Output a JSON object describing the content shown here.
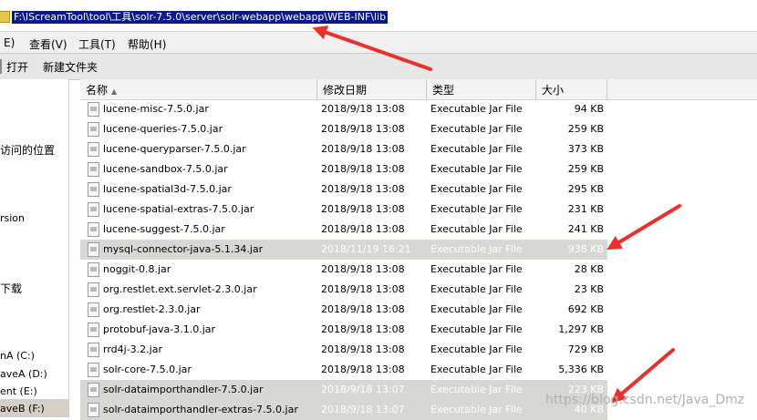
{
  "address": {
    "path": "F:\\IScreamTool\\tool\\工具\\solr-7.5.0\\server\\solr-webapp\\webapp\\WEB-INF\\lib"
  },
  "menu": {
    "edit": "E)",
    "view": "查看(V)",
    "tools": "工具(T)",
    "help": "帮助(H)"
  },
  "toolbar": {
    "open": "打开",
    "new_folder": "新建文件夹"
  },
  "nav": {
    "recent": "访问的位置",
    "version": "rsion",
    "download": "下载",
    "drive_c": "nA (C:)",
    "drive_d": "aveA (D:)",
    "drive_e": "ent (E:)",
    "drive_f": "aveB (F:)"
  },
  "columns": {
    "name": "名称",
    "modified": "修改日期",
    "type": "类型",
    "size": "大小"
  },
  "files": [
    {
      "name": "lucene-misc-7.5.0.jar",
      "modified": "2018/9/18 13:08",
      "type": "Executable Jar File",
      "size": "94 KB",
      "highlighted": false
    },
    {
      "name": "lucene-queries-7.5.0.jar",
      "modified": "2018/9/18 13:08",
      "type": "Executable Jar File",
      "size": "259 KB",
      "highlighted": false
    },
    {
      "name": "lucene-queryparser-7.5.0.jar",
      "modified": "2018/9/18 13:08",
      "type": "Executable Jar File",
      "size": "373 KB",
      "highlighted": false
    },
    {
      "name": "lucene-sandbox-7.5.0.jar",
      "modified": "2018/9/18 13:08",
      "type": "Executable Jar File",
      "size": "259 KB",
      "highlighted": false
    },
    {
      "name": "lucene-spatial3d-7.5.0.jar",
      "modified": "2018/9/18 13:08",
      "type": "Executable Jar File",
      "size": "295 KB",
      "highlighted": false
    },
    {
      "name": "lucene-spatial-extras-7.5.0.jar",
      "modified": "2018/9/18 13:08",
      "type": "Executable Jar File",
      "size": "231 KB",
      "highlighted": false
    },
    {
      "name": "lucene-suggest-7.5.0.jar",
      "modified": "2018/9/18 13:08",
      "type": "Executable Jar File",
      "size": "241 KB",
      "highlighted": false
    },
    {
      "name": "mysql-connector-java-5.1.34.jar",
      "modified": "2018/11/19 16:21",
      "type": "Executable Jar File",
      "size": "938 KB",
      "highlighted": true
    },
    {
      "name": "noggit-0.8.jar",
      "modified": "2018/9/18 13:08",
      "type": "Executable Jar File",
      "size": "28 KB",
      "highlighted": false
    },
    {
      "name": "org.restlet.ext.servlet-2.3.0.jar",
      "modified": "2018/9/18 13:08",
      "type": "Executable Jar File",
      "size": "23 KB",
      "highlighted": false
    },
    {
      "name": "org.restlet-2.3.0.jar",
      "modified": "2018/9/18 13:08",
      "type": "Executable Jar File",
      "size": "692 KB",
      "highlighted": false
    },
    {
      "name": "protobuf-java-3.1.0.jar",
      "modified": "2018/9/18 13:08",
      "type": "Executable Jar File",
      "size": "1,297 KB",
      "highlighted": false
    },
    {
      "name": "rrd4j-3.2.jar",
      "modified": "2018/9/18 13:08",
      "type": "Executable Jar File",
      "size": "729 KB",
      "highlighted": false
    },
    {
      "name": "solr-core-7.5.0.jar",
      "modified": "2018/9/18 13:08",
      "type": "Executable Jar File",
      "size": "5,336 KB",
      "highlighted": false
    },
    {
      "name": "solr-dataimporthandler-7.5.0.jar",
      "modified": "2018/9/18 13:07",
      "type": "Executable Jar File",
      "size": "223 KB",
      "highlighted": true
    },
    {
      "name": "solr-dataimporthandler-extras-7.5.0.jar",
      "modified": "2018/9/18 13:07",
      "type": "Executable Jar File",
      "size": "40 KB",
      "highlighted": true
    }
  ],
  "watermark": "https://blog.csdn.net/Java_Dmz",
  "colors": {
    "address_highlight": "#0a1a8a",
    "arrow": "#e8312c",
    "row_highlight": "#d9d7d3"
  }
}
